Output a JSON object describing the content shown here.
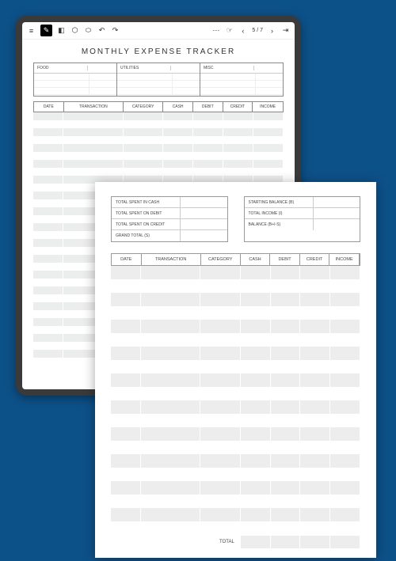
{
  "tablet": {
    "toolbar": {
      "page_indicator": "5 / 7"
    },
    "doc": {
      "title": "MONTHLY EXPENSE TRACKER",
      "categories": [
        "FOOD",
        "UTILITIES",
        "MISC"
      ],
      "ledger_headers": [
        "DATE",
        "TRANSACTION",
        "CATEGORY",
        "CASH",
        "DEBIT",
        "CREDIT",
        "INCOME"
      ]
    }
  },
  "sheet": {
    "summary_left": [
      "TOTAL SPENT IN CASH",
      "TOTAL SPENT ON DEBIT",
      "TOTAL SPENT ON CREDIT",
      "GRAND TOTAL (S)"
    ],
    "summary_right": [
      "STARTING BALANCE (B)",
      "TOTAL INCOME (I)",
      "BALANCE (B+I-S)"
    ],
    "ledger_headers": [
      "DATE",
      "TRANSACTION",
      "CATEGORY",
      "CASH",
      "DEBIT",
      "CREDIT",
      "INCOME"
    ],
    "total_label": "TOTAL"
  }
}
